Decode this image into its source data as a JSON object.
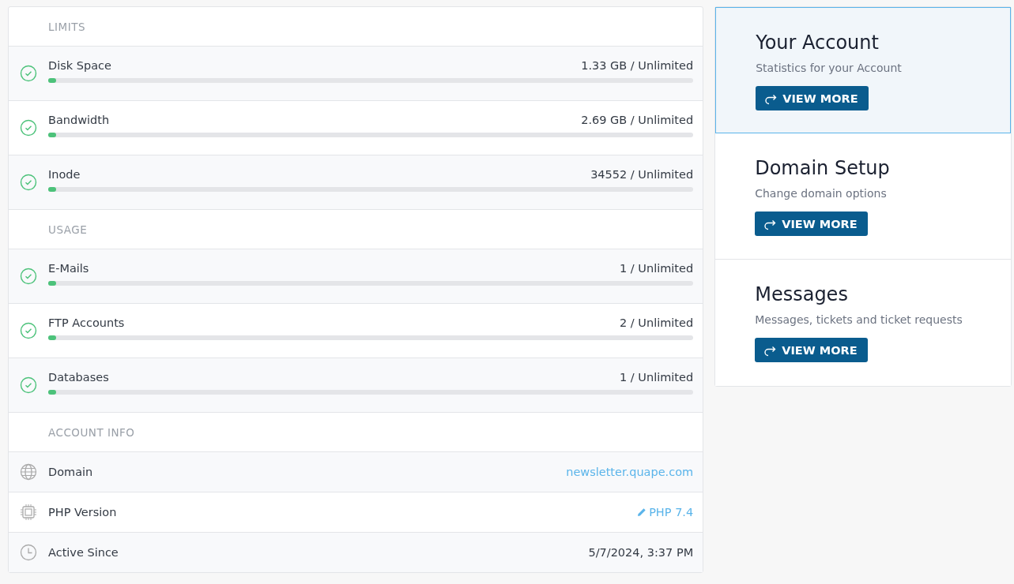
{
  "sections": [
    {
      "heading": "LIMITS",
      "items": [
        {
          "label": "Disk Space",
          "value": "1.33 GB / Unlimited",
          "level": 0.01,
          "ok": true
        },
        {
          "label": "Bandwidth",
          "value": "2.69 GB / Unlimited",
          "level": 0.01,
          "ok": true
        },
        {
          "label": "Inode",
          "value": "34552 / Unlimited",
          "level": 0.01,
          "ok": true
        }
      ]
    },
    {
      "heading": "USAGE",
      "items": [
        {
          "label": "E-Mails",
          "value": "1 / Unlimited",
          "level": 0.01,
          "ok": true
        },
        {
          "label": "FTP Accounts",
          "value": "2 / Unlimited",
          "level": 0.01,
          "ok": true
        },
        {
          "label": "Databases",
          "value": "1 / Unlimited",
          "level": 0.01,
          "ok": true
        }
      ]
    }
  ],
  "account_info": {
    "heading": "ACCOUNT INFO",
    "items": [
      {
        "kind": "domain",
        "label": "Domain",
        "value": "newsletter.quape.com"
      },
      {
        "kind": "php",
        "label": "PHP Version",
        "value": "PHP 7.4"
      },
      {
        "kind": "date",
        "label": "Active Since",
        "value": "5/7/2024, 3:37 PM"
      }
    ]
  },
  "cards": [
    {
      "title": "Your Account",
      "subtitle": "Statistics for your Account",
      "button": "VIEW MORE",
      "selected": true
    },
    {
      "title": "Domain Setup",
      "subtitle": "Change domain options",
      "button": "VIEW MORE",
      "selected": false
    },
    {
      "title": "Messages",
      "subtitle": "Messages, tickets and ticket requests",
      "button": "VIEW MORE",
      "selected": false
    }
  ]
}
